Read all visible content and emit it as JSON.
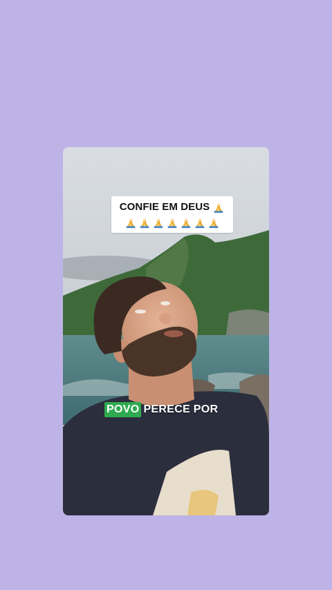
{
  "caption": {
    "line1_text": "CONFIE EM DEUS",
    "line1_emoji": "pray-icon",
    "line2_emojis": [
      "pray-icon",
      "pray-icon",
      "pray-icon",
      "pray-icon",
      "pray-icon",
      "pray-icon",
      "pray-icon"
    ]
  },
  "subtitle": {
    "highlight_word": "POVO",
    "rest": "PERECE POR",
    "highlight_color": "#2eaa4f"
  },
  "colors": {
    "background": "#bdb3e6",
    "caption_bg": "#ffffff"
  }
}
